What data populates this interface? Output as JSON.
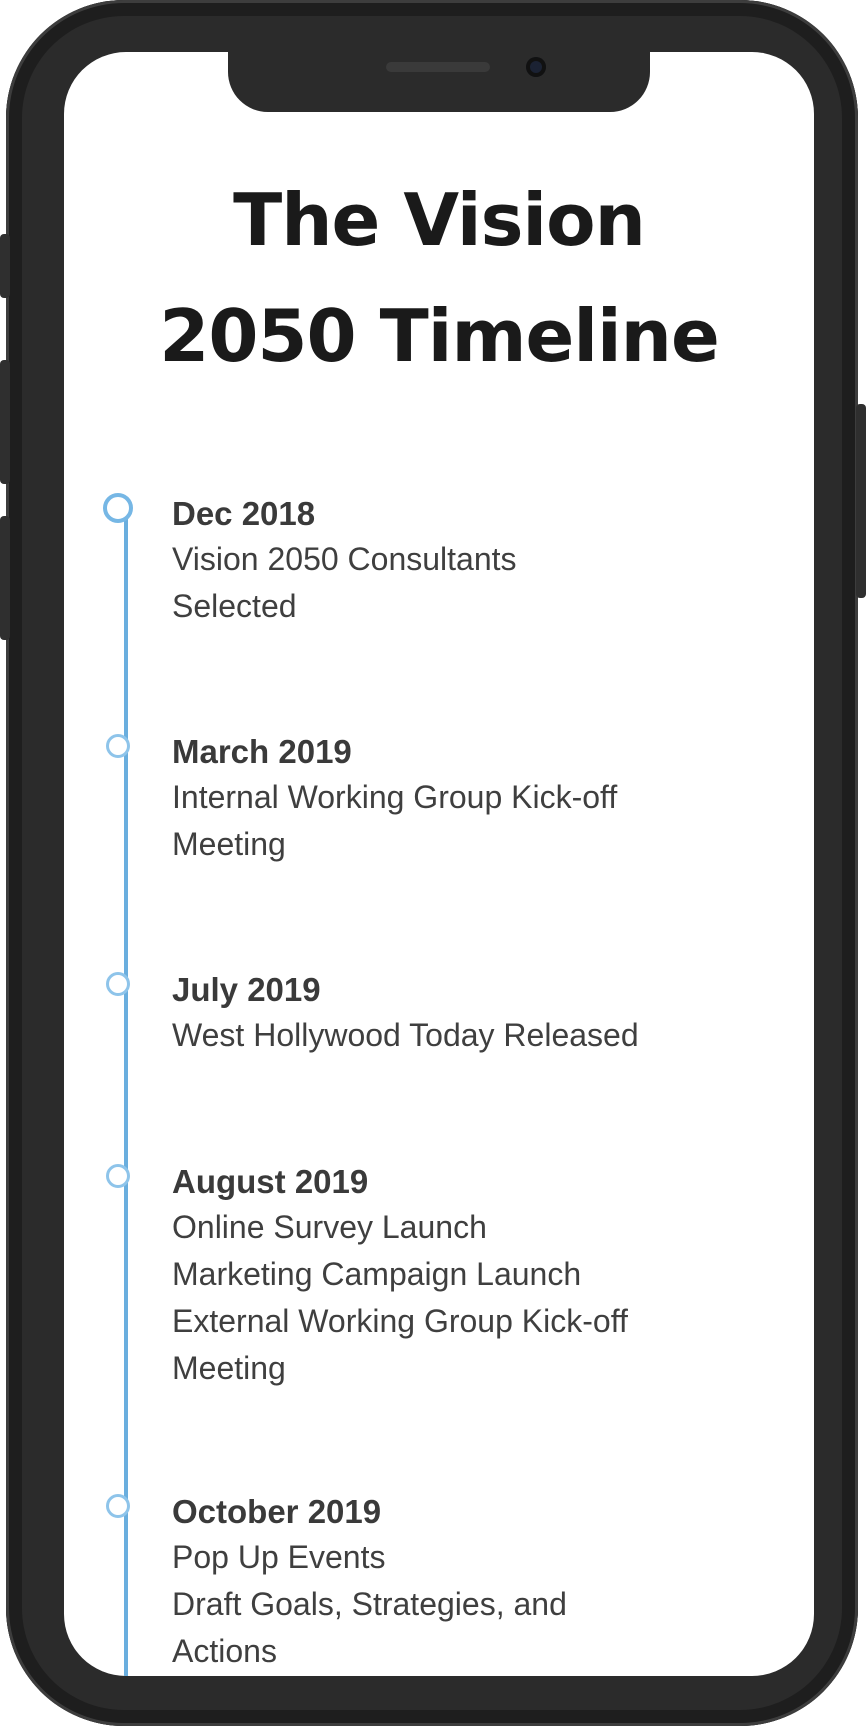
{
  "title": {
    "line1": "The Vision",
    "line2": "2050 Timeline"
  },
  "events": [
    {
      "date": "Dec 2018",
      "lines": [
        "Vision 2050 Consultants",
        "Selected"
      ]
    },
    {
      "date": "March 2019",
      "lines": [
        "Internal Working Group Kick-off",
        "Meeting"
      ]
    },
    {
      "date": "July 2019",
      "lines": [
        "West Hollywood Today Released"
      ]
    },
    {
      "date": "August 2019",
      "lines": [
        "Online Survey Launch",
        "Marketing Campaign Launch",
        "External Working Group Kick-off",
        "Meeting"
      ]
    },
    {
      "date": "October 2019",
      "lines": [
        "Pop Up Events",
        "Draft Goals, Strategies, and",
        "Actions"
      ]
    }
  ],
  "colors": {
    "accent": "#6aaede",
    "text": "#3f3f3f",
    "title": "#1a1a1a",
    "device": "#2b2b2b"
  }
}
